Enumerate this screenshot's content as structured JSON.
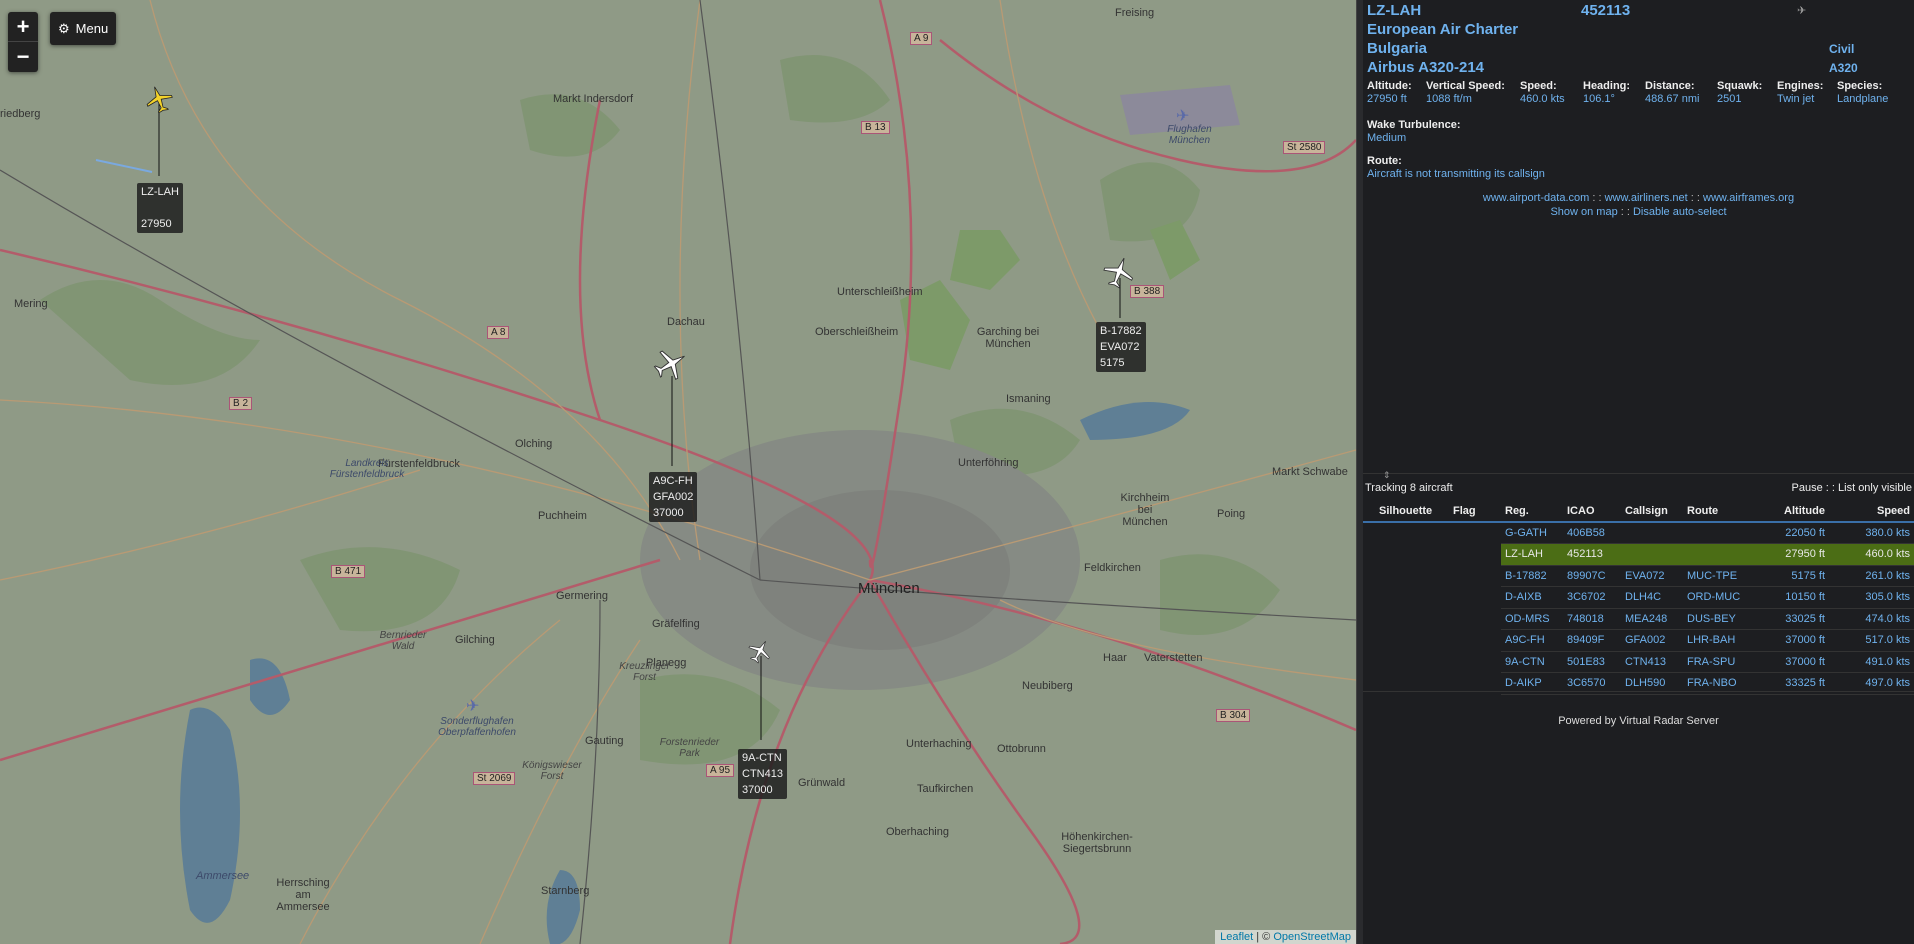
{
  "map": {
    "zoom_in": "+",
    "zoom_out": "−",
    "menu_label": "Menu",
    "attribution_leaflet": "Leaflet",
    "attribution_sep": " | © ",
    "attribution_osm": "OpenStreetMap",
    "places": {
      "munchen": "München",
      "freising": "Freising",
      "markt_indersdorf": "Markt Indersdorf",
      "dachau": "Dachau",
      "unterschleissheim": "Unterschleißheim",
      "oberschleissheim": "Oberschleißheim",
      "garching": "Garching bei München",
      "ismaning": "Ismaning",
      "unterfoehring": "Unterföhring",
      "olching": "Olching",
      "fuerstenfeldbruck": "Fürstenfeldbruck",
      "lk_fuerstenfeldbruck": "Landkreis Fürstenfeldbruck",
      "puchheim": "Puchheim",
      "germering": "Germering",
      "graefelfing": "Gräfelfing",
      "planegg": "Planegg",
      "gilching": "Gilching",
      "gauting": "Gauting",
      "gruenwald": "Grünwald",
      "unterhaching": "Unterhaching",
      "ottobrunn": "Ottobrunn",
      "neubiberg": "Neubiberg",
      "haar": "Haar",
      "vaterstetten": "Vaterstetten",
      "feldkirchen": "Feldkirchen",
      "kirchheim": "Kirchheim bei München",
      "poing": "Poing",
      "markt_schwaben": "Markt Schwabe",
      "mering": "Mering",
      "friedberg": "riedberg",
      "taufkirchen": "Taufkirchen",
      "oberhaching": "Oberhaching",
      "hoehenkirchen": "Höhenkirchen-Siegertsbrunn",
      "herrsching": "Herrsching am Ammersee",
      "starnberg": "Starnberg",
      "ammersee": "Ammersee",
      "flughafen": "Flughafen München",
      "sonderflughafen": "Sonderflughafen Oberpfaffenhofen",
      "forstenrieder": "Forstenrieder Park",
      "kreuzlinger": "Kreuzlinger Forst",
      "koenigswieser": "Königswieser Forst",
      "bernrieder": "Bernrieder Wald"
    },
    "roads": [
      "A 9",
      "B 13",
      "St 2580",
      "B 388",
      "A 8",
      "B 2",
      "B 471",
      "A 95",
      "St 2069",
      "B 304"
    ],
    "aircraft": [
      {
        "reg": "LZ-LAH",
        "line2": "",
        "alt": "27950",
        "color": "#f3d22a"
      },
      {
        "reg": "B-17882",
        "line2": "EVA072",
        "alt": "5175",
        "color": "#ffffff"
      },
      {
        "reg": "A9C-FH",
        "line2": "GFA002",
        "alt": "37000",
        "color": "#ffffff"
      },
      {
        "reg": "9A-CTN",
        "line2": "CTN413",
        "alt": "37000",
        "color": "#ffffff"
      }
    ]
  },
  "detail": {
    "reg": "LZ-LAH",
    "icao": "452113",
    "operator": "European Air Charter",
    "country": "Bulgaria",
    "model": "Airbus A320-214",
    "civil": "Civil",
    "type": "A320",
    "fields": [
      {
        "k": "Altitude:",
        "v": "27950 ft"
      },
      {
        "k": "Vertical Speed:",
        "v": "1088 ft/m"
      },
      {
        "k": "Speed:",
        "v": "460.0 kts"
      },
      {
        "k": "Heading:",
        "v": "106.1°"
      },
      {
        "k": "Distance:",
        "v": "488.67 nmi"
      },
      {
        "k": "Squawk:",
        "v": "2501"
      },
      {
        "k": "Engines:",
        "v": "Twin jet"
      },
      {
        "k": "Species:",
        "v": "Landplane"
      }
    ],
    "wake_k": "Wake Turbulence:",
    "wake_v": "Medium",
    "route_k": "Route:",
    "route_v": "Aircraft is not transmitting its callsign",
    "link1": "www.airport-data.com",
    "link2": "www.airliners.net",
    "link3": "www.airframes.org",
    "link_sep": " : : ",
    "show_on_map": "Show on map",
    "disable_auto": "Disable auto-select"
  },
  "list": {
    "tracking": "Tracking 8 aircraft",
    "pause": "Pause",
    "pause_sep": " : : ",
    "only_visible": "List only visible",
    "headers": [
      "Silhouette",
      "Flag",
      "Reg.",
      "ICAO",
      "Callsign",
      "Route",
      "Altitude",
      "Speed"
    ],
    "rows": [
      [
        "G-GATH",
        "406B58",
        "",
        "",
        "22050 ft",
        "380.0 kts"
      ],
      [
        "LZ-LAH",
        "452113",
        "",
        "",
        "27950 ft",
        "460.0 kts"
      ],
      [
        "B-17882",
        "89907C",
        "EVA072",
        "MUC-TPE",
        "5175 ft",
        "261.0 kts"
      ],
      [
        "D-AIXB",
        "3C6702",
        "DLH4C",
        "ORD-MUC",
        "10150 ft",
        "305.0 kts"
      ],
      [
        "OD-MRS",
        "748018",
        "MEA248",
        "DUS-BEY",
        "33025 ft",
        "474.0 kts"
      ],
      [
        "A9C-FH",
        "89409F",
        "GFA002",
        "LHR-BAH",
        "37000 ft",
        "517.0 kts"
      ],
      [
        "9A-CTN",
        "501E83",
        "CTN413",
        "FRA-SPU",
        "37000 ft",
        "491.0 kts"
      ],
      [
        "D-AIKP",
        "3C6570",
        "DLH590",
        "FRA-NBO",
        "33325 ft",
        "497.0 kts"
      ]
    ],
    "selected_index": 1,
    "powered": "Powered by Virtual Radar Server"
  }
}
